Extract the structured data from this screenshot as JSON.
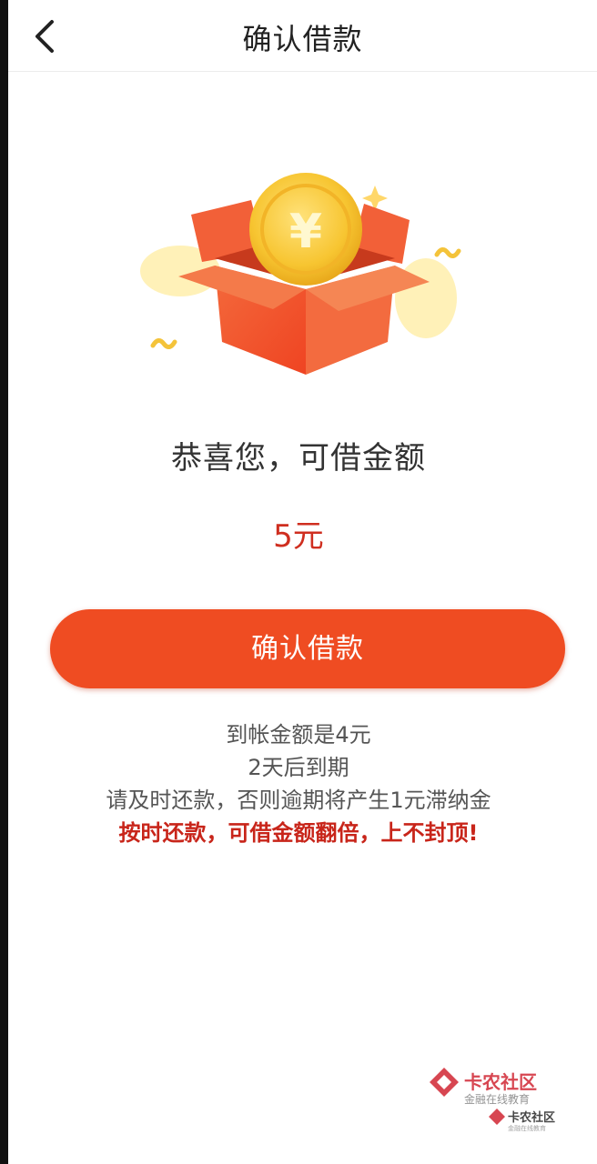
{
  "header": {
    "title": "确认借款",
    "back_icon": "chevron-left-icon"
  },
  "main": {
    "headline": "恭喜您，可借金额",
    "amount": "5元",
    "confirm_button_label": "确认借款",
    "info_lines": [
      "到帐金额是4元",
      "2天后到期",
      "请及时还款，否则逾期将产生1元滞纳金"
    ],
    "warning": "按时还款，可借金额翻倍，上不封顶!"
  },
  "watermark": {
    "name": "卡农社区",
    "subtitle": "金融在线教育",
    "name_small": "卡农社区",
    "subtitle_small": "金融在线教育"
  },
  "colors": {
    "accent": "#ef4c22",
    "amount": "#cf2e1f",
    "warning": "#c8251a",
    "coin": "#f7c531",
    "box": "#f05a32"
  }
}
